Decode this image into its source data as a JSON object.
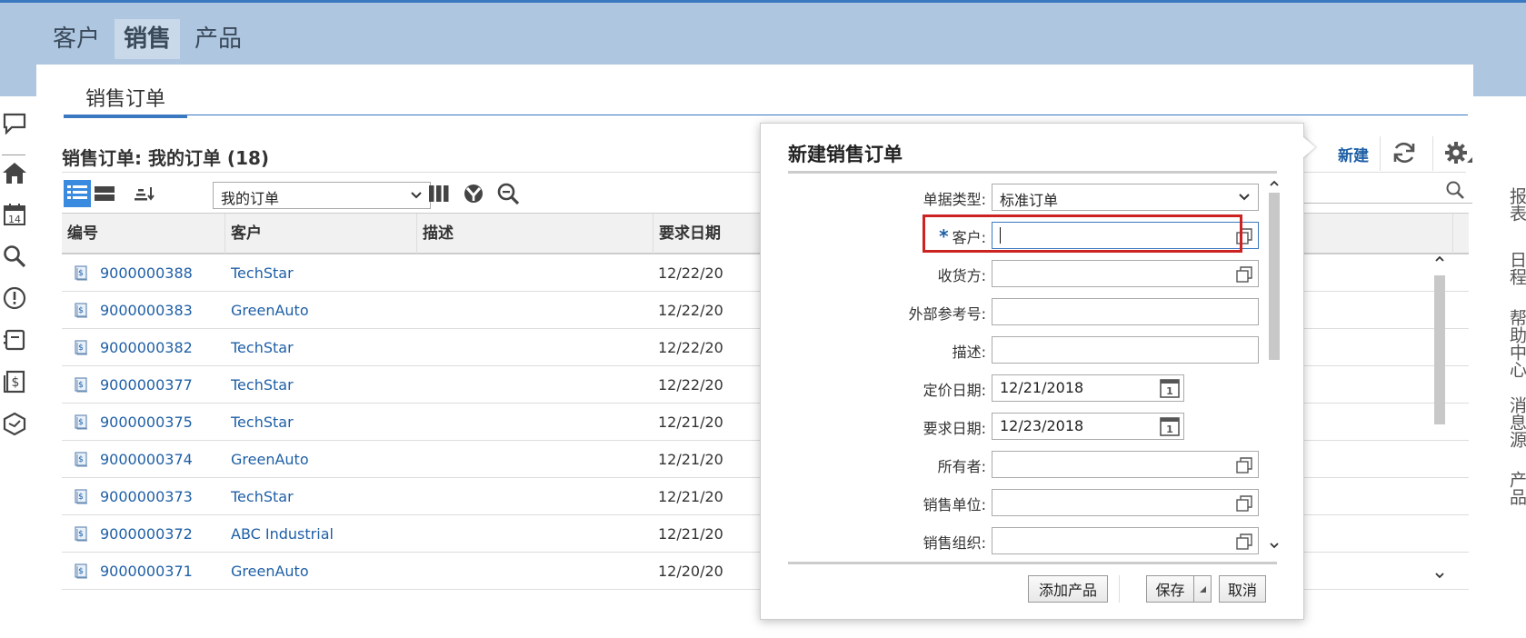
{
  "topnav": {
    "tabs": [
      {
        "label": "客户"
      },
      {
        "label": "销售"
      },
      {
        "label": "产品"
      }
    ],
    "active_index": 1
  },
  "left_rail": {
    "icons": [
      "chat-icon",
      "home-icon",
      "calendar-icon",
      "search-icon",
      "alert-icon",
      "inbox-icon",
      "dollar-doc-icon",
      "cube-icon"
    ],
    "calendar_day": "14"
  },
  "right_rail": {
    "labels": [
      "报表",
      "日程",
      "帮助中心",
      "消息源",
      "产品"
    ]
  },
  "subtab": {
    "label": "销售订单"
  },
  "page": {
    "title": "销售订单: 我的订单 (18)",
    "new_label": "新建"
  },
  "toolbar": {
    "view_select": "我的订单"
  },
  "table": {
    "columns": [
      "编号",
      "客户",
      "描述",
      "要求日期"
    ],
    "rows": [
      {
        "id": "9000000388",
        "customer": "TechStar",
        "desc": "",
        "date": "12/22/20"
      },
      {
        "id": "9000000383",
        "customer": "GreenAuto",
        "desc": "",
        "date": "12/22/20"
      },
      {
        "id": "9000000382",
        "customer": "TechStar",
        "desc": "",
        "date": "12/22/20"
      },
      {
        "id": "9000000377",
        "customer": "TechStar",
        "desc": "",
        "date": "12/22/20"
      },
      {
        "id": "9000000375",
        "customer": "TechStar",
        "desc": "",
        "date": "12/21/20"
      },
      {
        "id": "9000000374",
        "customer": "GreenAuto",
        "desc": "",
        "date": "12/21/20"
      },
      {
        "id": "9000000373",
        "customer": "TechStar",
        "desc": "",
        "date": "12/21/20"
      },
      {
        "id": "9000000372",
        "customer": "ABC Industrial",
        "desc": "",
        "date": "12/21/20"
      },
      {
        "id": "9000000371",
        "customer": "GreenAuto",
        "desc": "",
        "date": "12/20/20"
      }
    ]
  },
  "dialog": {
    "title": "新建销售订单",
    "fields": {
      "doc_type": {
        "label": "单据类型:",
        "value": "标准订单"
      },
      "customer": {
        "label": "客户:",
        "value": "",
        "required_mark": "*"
      },
      "ship_to": {
        "label": "收货方:",
        "value": ""
      },
      "ext_ref": {
        "label": "外部参考号:",
        "value": ""
      },
      "desc": {
        "label": "描述:",
        "value": ""
      },
      "price_date": {
        "label": "定价日期:",
        "value": "12/21/2018"
      },
      "req_date": {
        "label": "要求日期:",
        "value": "12/23/2018"
      },
      "owner": {
        "label": "所有者:",
        "value": ""
      },
      "sales_unit": {
        "label": "销售单位:",
        "value": ""
      },
      "sales_org": {
        "label": "销售组织:",
        "value": ""
      }
    },
    "buttons": {
      "add_product": "添加产品",
      "save": "保存",
      "cancel": "取消"
    }
  },
  "colors": {
    "header_bg": "#aec6e0",
    "link": "#1f5fa6",
    "highlight": "#cc2222",
    "selected": "#3a8be0"
  }
}
